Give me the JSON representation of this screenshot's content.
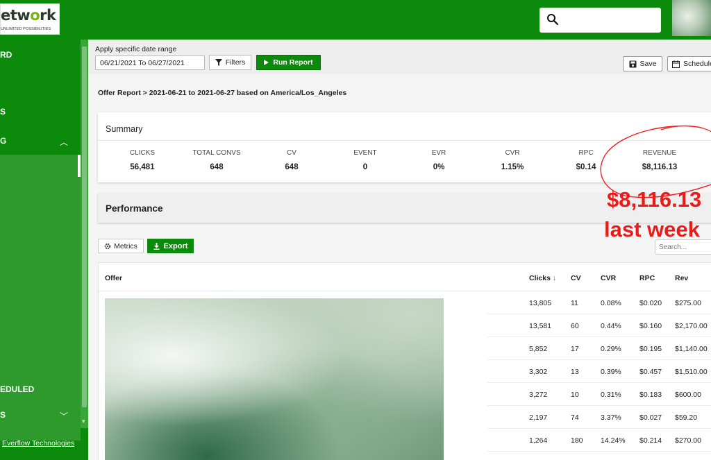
{
  "logo": {
    "title_part1": "etw",
    "title_o": "o",
    "title_part2": "rk",
    "tagline": "UNLIMITED POSSIBILITIES"
  },
  "sidebar": {
    "items": [
      {
        "label": "RD"
      },
      {
        "label": "S"
      },
      {
        "label": "G"
      },
      {
        "label": "EDULED"
      },
      {
        "label": "S"
      }
    ],
    "footer_link": "Everflow Technologies"
  },
  "toolbar": {
    "date_label": "Apply specific date range",
    "date_value": "06/21/2021 To 06/27/2021",
    "filters_label": "Filters",
    "run_label": "Run Report",
    "save_label": "Save",
    "schedule_label": "Schedule"
  },
  "breadcrumb": "Offer Report > 2021-06-21 to 2021-06-27 based on America/Los_Angeles",
  "summary": {
    "title": "Summary",
    "metrics": [
      {
        "label": "CLICKS",
        "value": "56,481"
      },
      {
        "label": "TOTAL CONVS",
        "value": "648"
      },
      {
        "label": "CV",
        "value": "648"
      },
      {
        "label": "EVENT",
        "value": "0"
      },
      {
        "label": "EVR",
        "value": "0%"
      },
      {
        "label": "CVR",
        "value": "1.15%"
      },
      {
        "label": "RPC",
        "value": "$0.14"
      },
      {
        "label": "REVENUE",
        "value": "$8,116.13"
      }
    ]
  },
  "performance": {
    "title": "Performance"
  },
  "table_controls": {
    "metrics_label": "Metrics",
    "export_label": "Export",
    "search_placeholder": "Search..."
  },
  "table": {
    "headers": {
      "offer": "Offer",
      "clicks": "Clicks",
      "cv": "CV",
      "cvr": "CVR",
      "rpc": "RPC",
      "rev": "Rev"
    },
    "rows": [
      {
        "clicks": "13,805",
        "cv": "11",
        "cvr": "0.08%",
        "rpc": "$0.020",
        "rev": "$275.00"
      },
      {
        "clicks": "13,581",
        "cv": "60",
        "cvr": "0.44%",
        "rpc": "$0.160",
        "rev": "$2,170.00"
      },
      {
        "clicks": "5,852",
        "cv": "17",
        "cvr": "0.29%",
        "rpc": "$0.195",
        "rev": "$1,140.00"
      },
      {
        "clicks": "3,302",
        "cv": "13",
        "cvr": "0.39%",
        "rpc": "$0.457",
        "rev": "$1,510.00"
      },
      {
        "clicks": "3,272",
        "cv": "10",
        "cvr": "0.31%",
        "rpc": "$0.183",
        "rev": "$600.00"
      },
      {
        "clicks": "2,197",
        "cv": "74",
        "cvr": "3.37%",
        "rpc": "$0.027",
        "rev": "$59.20"
      },
      {
        "clicks": "1,264",
        "cv": "180",
        "cvr": "14.24%",
        "rpc": "$0.214",
        "rev": "$270.00"
      }
    ]
  },
  "annotation": {
    "amount": "$8,116.13",
    "caption": "last week",
    "color": "#ee1a1a"
  },
  "colors": {
    "brand_green": "#0b8a0b",
    "sidebar_sub": "#2e9a2e"
  }
}
